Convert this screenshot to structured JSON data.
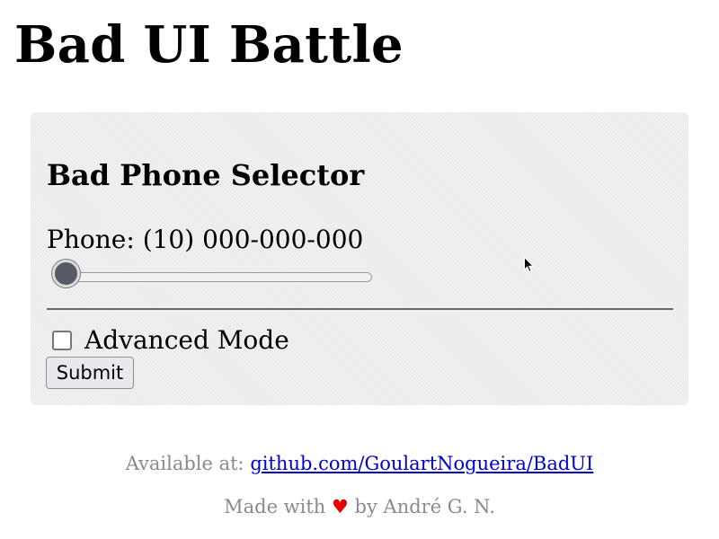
{
  "page": {
    "title": "Bad UI Battle"
  },
  "card": {
    "title": "Bad Phone Selector",
    "phone_label": "Phone:",
    "phone_value": "(10) 000-000-000",
    "slider_fraction": 0,
    "advanced_mode_label": "Advanced Mode",
    "advanced_mode_checked": false,
    "submit_label": "Submit"
  },
  "footer": {
    "available_label": "Available at:",
    "repo_link": "github.com/GoulartNogueira/BadUI",
    "made_with_prefix": "Made with",
    "heart_glyph": "♥",
    "made_with_suffix": "by André G. N."
  },
  "colors": {
    "link": "#0000cc",
    "heart": "#e00000",
    "footer_text": "#8a8a8a",
    "card_background": "#ececec",
    "slider_thumb": "#555a66"
  },
  "icons": {
    "cursor": "mouse-pointer-icon",
    "heart": "heart-icon"
  }
}
